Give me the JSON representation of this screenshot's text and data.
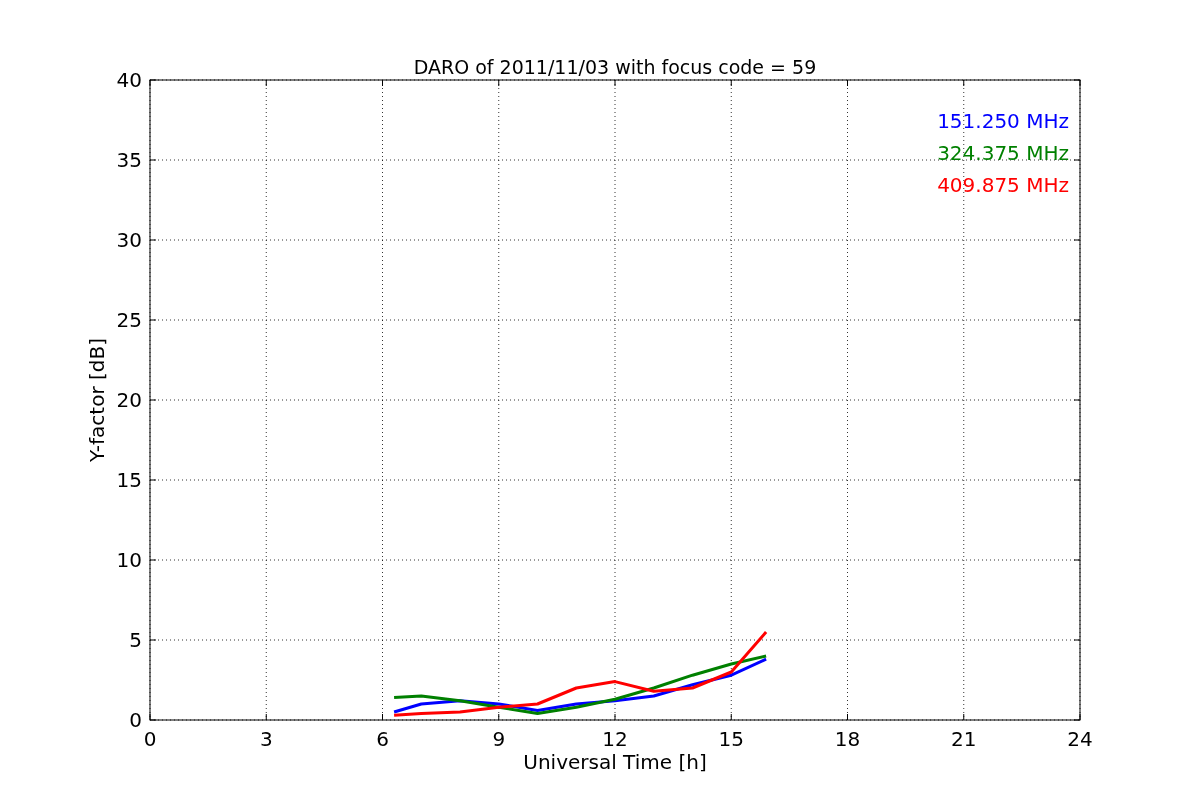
{
  "chart_data": {
    "type": "line",
    "title": "DARO of 2011/11/03 with focus code = 59",
    "xlabel": "Universal Time [h]",
    "ylabel": "Y-factor [dB]",
    "x": [
      6.3,
      7,
      8,
      9,
      10,
      11,
      12,
      13,
      14,
      15,
      15.9
    ],
    "series": [
      {
        "name": "151.250 MHz",
        "color": "#0000ff",
        "values": [
          0.5,
          1.0,
          1.2,
          1.0,
          0.6,
          1.0,
          1.2,
          1.5,
          2.2,
          2.8,
          3.8
        ]
      },
      {
        "name": "324.375 MHz",
        "color": "#008000",
        "values": [
          1.4,
          1.5,
          1.2,
          0.8,
          0.4,
          0.8,
          1.3,
          2.0,
          2.8,
          3.5,
          4.0
        ]
      },
      {
        "name": "409.875 MHz",
        "color": "#ff0000",
        "values": [
          0.3,
          0.4,
          0.5,
          0.8,
          1.0,
          2.0,
          2.4,
          1.8,
          2.0,
          3.0,
          5.5
        ]
      }
    ],
    "grid": true,
    "xlim": [
      0,
      24
    ],
    "ylim": [
      0,
      40
    ],
    "xticks": [
      0,
      3,
      6,
      9,
      12,
      15,
      18,
      21,
      24
    ],
    "yticks": [
      0,
      5,
      10,
      15,
      20,
      25,
      30,
      35,
      40
    ]
  }
}
